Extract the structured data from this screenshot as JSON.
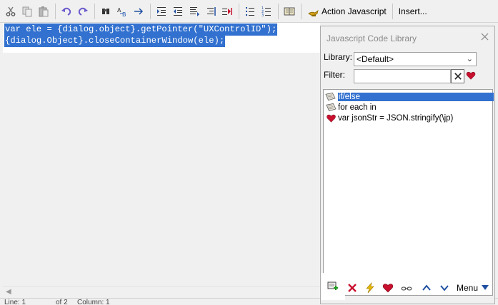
{
  "toolbar": {
    "buttons": [
      "scissors-icon",
      "copy-icon",
      "paste-icon",
      "undo-icon",
      "redo-icon",
      "binoculars-icon",
      "replace-icon",
      "arrow-right-icon",
      "indent-icon",
      "outdent-icon",
      "align-icon",
      "right-align-icon",
      "bookmark-icon",
      "bullets-icon",
      "numbered-icon",
      "book-icon"
    ],
    "action_javascript": "Action Javascript",
    "insert": "Insert..."
  },
  "editor": {
    "lines": [
      "var ele = {dialog.object}.getPointer(\"UXControlID\");",
      "{dialog.Object}.closeContainerWindow(ele);"
    ]
  },
  "status": {
    "line": "Line: 1",
    "of": "of 2",
    "column": "Column: 1"
  },
  "library_panel": {
    "title": "Javascript Code Library",
    "library_label": "Library:",
    "library_value": "<Default>",
    "filter_label": "Filter:",
    "filter_value": "",
    "items": [
      {
        "text": "if/else",
        "icon": "scroll-icon",
        "selected": true
      },
      {
        "text": "for each in",
        "icon": "scroll-icon",
        "selected": false
      },
      {
        "text": "var jsonStr = JSON.stringify(\\jp)",
        "icon": "heart-icon",
        "selected": false
      }
    ],
    "menu_label": "Menu"
  },
  "colors": {
    "selection": "#3271cf",
    "background": "#f0f0f0",
    "heart": "#c8102e"
  }
}
